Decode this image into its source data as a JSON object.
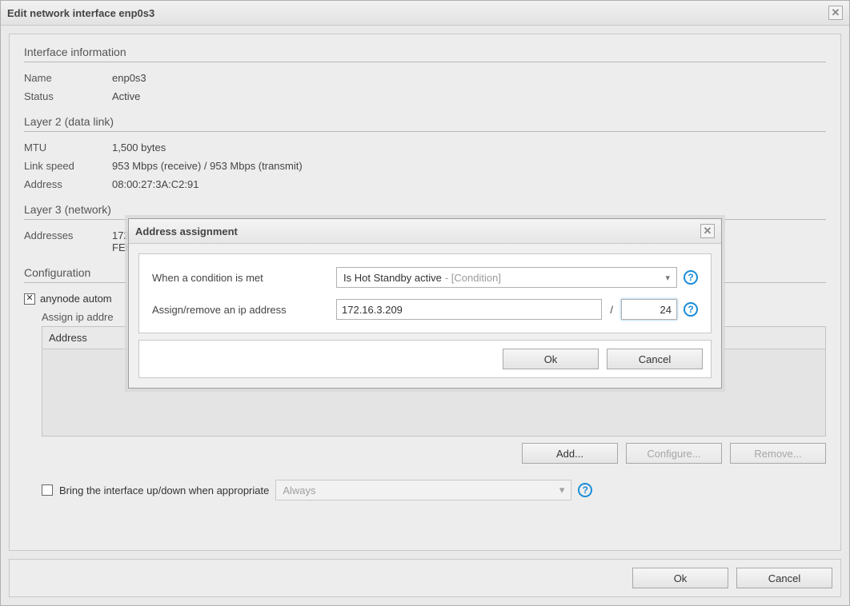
{
  "window": {
    "title": "Edit network interface enp0s3"
  },
  "sections": {
    "info": {
      "heading": "Interface information",
      "name_label": "Name",
      "name_value": "enp0s3",
      "status_label": "Status",
      "status_value": "Active"
    },
    "layer2": {
      "heading": "Layer 2 (data link)",
      "mtu_label": "MTU",
      "mtu_value": "1,500 bytes",
      "linkspeed_label": "Link speed",
      "linkspeed_value": "953 Mbps (receive) / 953 Mbps (transmit)",
      "address_label": "Address",
      "address_value": "08:00:27:3A:C2:91"
    },
    "layer3": {
      "heading": "Layer 3 (network)",
      "addresses_label": "Addresses",
      "addresses_value_line1": "172",
      "addresses_value_line2": "FE8"
    },
    "config": {
      "heading": "Configuration",
      "auto_checkbox_label": "anynode autom",
      "auto_checkbox_checked": "✕",
      "assign_label": "Assign ip addre",
      "grid_header": "Address",
      "add_btn": "Add...",
      "configure_btn": "Configure...",
      "remove_btn": "Remove...",
      "bring_checkbox_label": "Bring the interface up/down when appropriate",
      "bring_select_value": "Always"
    }
  },
  "footer": {
    "ok": "Ok",
    "cancel": "Cancel"
  },
  "modal": {
    "title": "Address assignment",
    "row1_label": "When a condition is met",
    "row1_value": "Is Hot Standby active",
    "row1_hint": " - [Condition]",
    "row2_label": "Assign/remove an ip address",
    "ip_value": "172.16.3.209",
    "slash": "/",
    "mask_value": "24",
    "ok": "Ok",
    "cancel": "Cancel"
  }
}
